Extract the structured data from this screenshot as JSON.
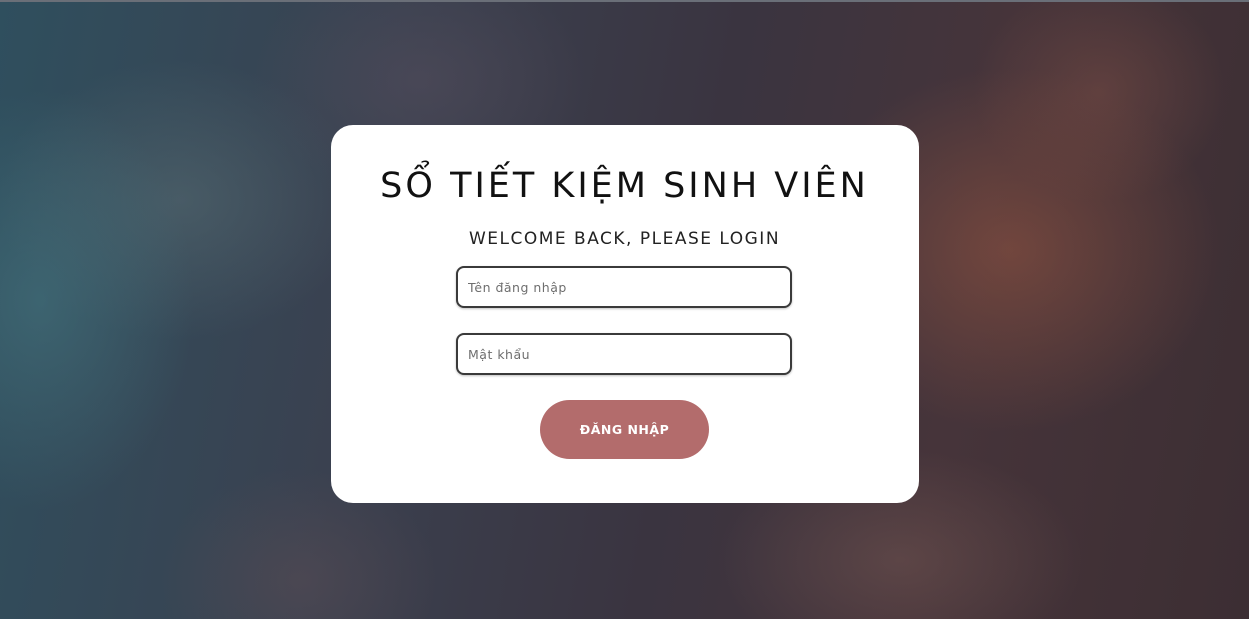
{
  "login": {
    "title": "SỔ TIẾT KIỆM SINH VIÊN",
    "subtitle": "WELCOME BACK, PLEASE LOGIN",
    "username": {
      "value": "",
      "placeholder": "Tên đăng nhập"
    },
    "password": {
      "value": "",
      "placeholder": "Mật khẩu"
    },
    "submit_label": "ĐĂNG NHẬP"
  },
  "colors": {
    "button": "#b36c6c",
    "card": "#ffffff",
    "title_text": "#111111"
  }
}
